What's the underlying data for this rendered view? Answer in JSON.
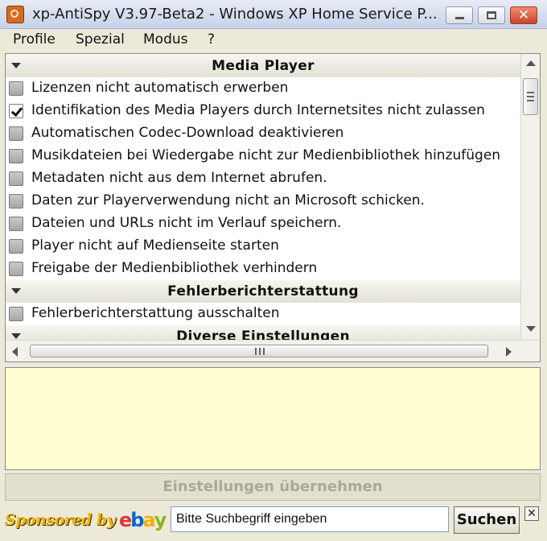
{
  "window": {
    "title": "xp-AntiSpy V3.97-Beta2 - Windows XP Home Service P...",
    "minimize_icon": "minimize-icon",
    "maximize_icon": "maximize-icon",
    "close_glyph": "✕"
  },
  "menu": {
    "items": [
      {
        "label": "Profile"
      },
      {
        "label": "Spezial"
      },
      {
        "label": "Modus"
      },
      {
        "label": "?"
      }
    ]
  },
  "list": {
    "sections": [
      {
        "title": "Media Player",
        "items": [
          {
            "label": "Lizenzen nicht automatisch erwerben",
            "checked": false
          },
          {
            "label": "Identifikation des Media Players durch Internetsites nicht zulassen",
            "checked": true
          },
          {
            "label": "Automatischen Codec-Download deaktivieren",
            "checked": false
          },
          {
            "label": "Musikdateien bei Wiedergabe nicht zur Medienbibliothek hinzufügen",
            "checked": false
          },
          {
            "label": "Metadaten nicht aus dem Internet abrufen.",
            "checked": false
          },
          {
            "label": "Daten zur Playerverwendung nicht an Microsoft schicken.",
            "checked": false
          },
          {
            "label": "Dateien und URLs nicht im Verlauf speichern.",
            "checked": false
          },
          {
            "label": "Player nicht auf Medienseite starten",
            "checked": false
          },
          {
            "label": "Freigabe der Medienbibliothek verhindern",
            "checked": false
          }
        ]
      },
      {
        "title": "Fehlerberichterstattung",
        "items": [
          {
            "label": "Fehlerberichterstattung ausschalten",
            "checked": false
          }
        ]
      },
      {
        "title": "Diverse Einstellungen",
        "items": []
      }
    ]
  },
  "scrollbar": {
    "h_thumb_grip": "III"
  },
  "description": {
    "text": ""
  },
  "apply": {
    "label": "Einstellungen übernehmen",
    "enabled": false
  },
  "sponsor": {
    "text": "Sponsored by",
    "logo": [
      "e",
      "b",
      "a",
      "y"
    ],
    "logo_colors": [
      "#E53238",
      "#0064D2",
      "#F5AF02",
      "#86B817"
    ],
    "search_value": "Bitte Suchbegriff eingeben",
    "search_button": "Suchen",
    "close_glyph": "✕"
  }
}
